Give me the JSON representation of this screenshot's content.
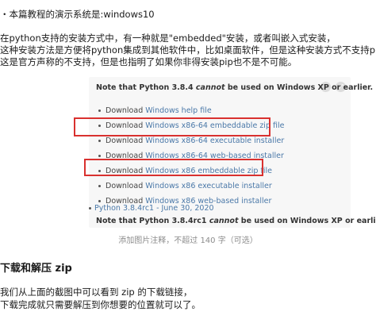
{
  "article": {
    "line1": "・本篇教程的演示系统是:windows10",
    "line2": "在python支持的安装方式中，有一种就是\"embedded\"安装，或者叫嵌入式安装，",
    "line3": "这种安装方法是方便将python集成到其他软件中，比如桌面软件，但是这种安装方式不支持pip,",
    "line4": "这是官方声称的不支持，但是也指明了如果你非得安装pip也不是不可能。"
  },
  "screenshot": {
    "note_prefix": "Note that Python 3.8.4 ",
    "note_emph": "cannot",
    "note_suffix": " be used on Windows XP or earlier.",
    "items": [
      {
        "prefix": "Download ",
        "link": "Windows help file"
      },
      {
        "prefix": "Download ",
        "link": "Windows x86-64 embeddable zip file"
      },
      {
        "prefix": "Download ",
        "link": "Windows x86-64 executable installer"
      },
      {
        "prefix": "Download ",
        "link": "Windows x86-64 web-based installer"
      },
      {
        "prefix": "Download ",
        "link": "Windows x86 embeddable zip file"
      },
      {
        "prefix": "Download ",
        "link": "Windows x86 executable installer"
      },
      {
        "prefix": "Download ",
        "link": "Windows x86 web-based installer"
      }
    ],
    "release": "Python 3.8.4rc1 - June 30, 2020",
    "note2_prefix": "Note that Python 3.8.4rc1 ",
    "note2_emph": "cannot",
    "note2_suffix": " be used on Windows XP or earlier.",
    "ctrl_a_icon": "gear-icon",
    "ctrl_b_icon": "expand-icon",
    "highlight_color": "#d9312f"
  },
  "caption": "添加图片注释，不超过 140 字（可选）",
  "section": {
    "heading": "下载和解压 zip",
    "p1": "我们从上面的截图中可以看到 zip 的下载链接，",
    "p2": "下载完成就只需要解压到你想要的位置就可以了。"
  }
}
